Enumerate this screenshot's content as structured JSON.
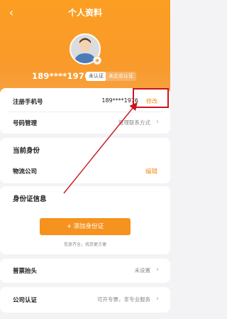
{
  "nav": {
    "back_icon": "chevron-left-icon",
    "title": "个人资料"
  },
  "profile": {
    "phone": "189****1976",
    "badge_unverified": "未认证",
    "badge_company": "未企业认证"
  },
  "account": {
    "phone_label": "注册手机号",
    "phone_value": "189****1976",
    "phone_action": "修改",
    "number_label": "号码管理",
    "number_value": "管理联系方式"
  },
  "identity": {
    "title": "当前身份",
    "role_label": "物流公司",
    "role_action": "编辑"
  },
  "id_card": {
    "title": "身份证信息",
    "add_button": "+ 添加身份证",
    "hint": "信息齐全，找货更方便"
  },
  "invoice": {
    "label": "普票抬头",
    "value": "未设置"
  },
  "company": {
    "label": "公司认证",
    "value": "可开专票，享专业服务"
  },
  "colors": {
    "accent": "#f6921e",
    "highlight": "#c8151d"
  }
}
